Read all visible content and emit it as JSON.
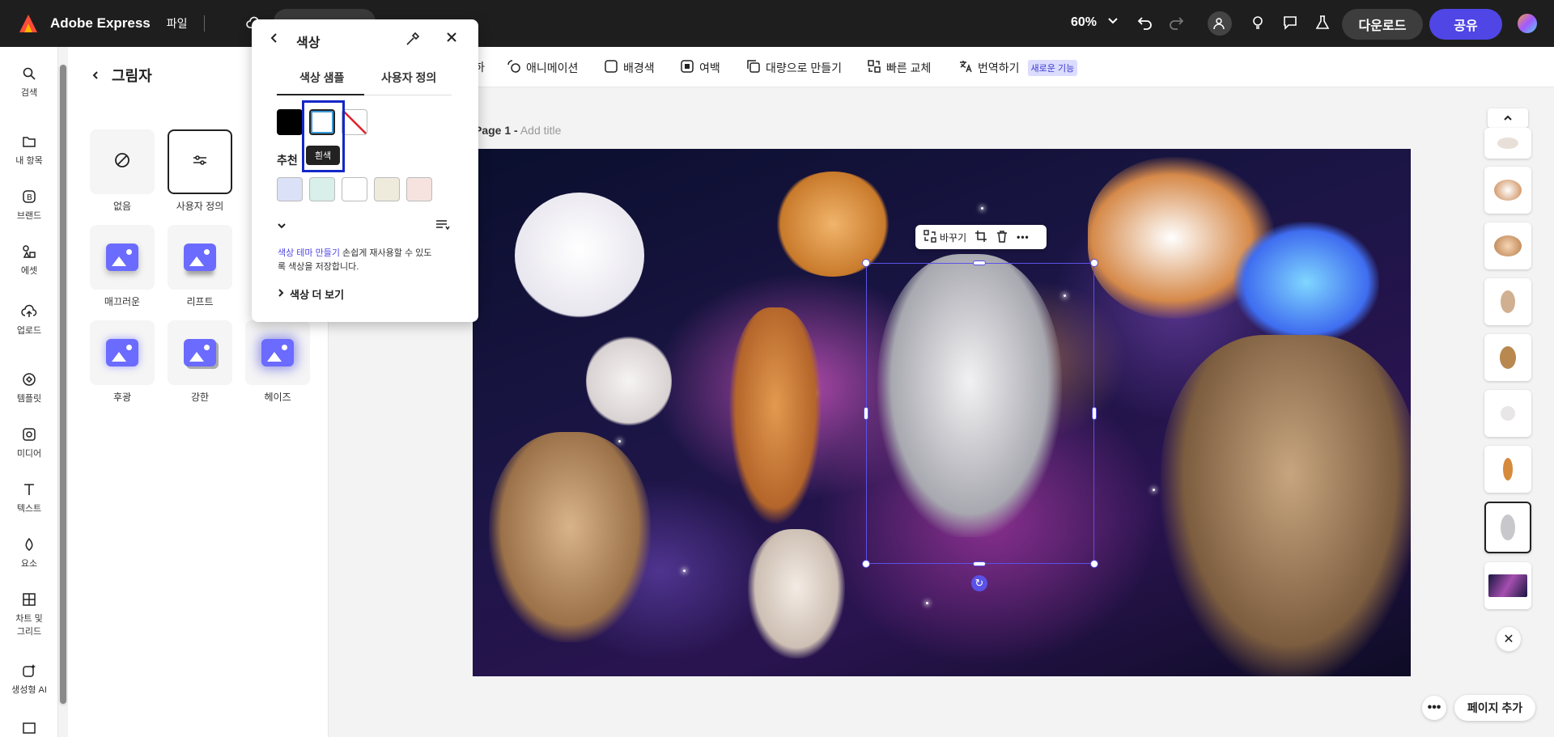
{
  "app": {
    "name": "Adobe Express",
    "file_menu": "파일",
    "zoom": "60%"
  },
  "header": {
    "download": "다운로드",
    "share": "공유"
  },
  "rail": [
    {
      "label": "검색",
      "icon": "search-icon"
    },
    {
      "label": "내 항목",
      "icon": "folder-icon"
    },
    {
      "label": "브랜드",
      "icon": "brand-icon"
    },
    {
      "label": "에셋",
      "icon": "assets-icon"
    },
    {
      "label": "업로드",
      "icon": "upload-icon"
    },
    {
      "label": "템플릿",
      "icon": "template-icon"
    },
    {
      "label": "미디어",
      "icon": "media-icon"
    },
    {
      "label": "텍스트",
      "icon": "text-icon"
    },
    {
      "label": "요소",
      "icon": "elements-icon"
    },
    {
      "label": "차트 및",
      "label2": "그리드",
      "icon": "chart-icon"
    },
    {
      "label": "생성형 AI",
      "icon": "ai-icon"
    }
  ],
  "shadow_panel": {
    "title": "그림자",
    "tiles": [
      {
        "label": "없음",
        "icon": "none-icon"
      },
      {
        "label": "사용자 정의",
        "icon": "sliders-icon"
      },
      {
        "label": "매끄러운",
        "icon": "image-icon"
      },
      {
        "label": "리프트",
        "icon": "image-icon"
      },
      {
        "label": "후광",
        "icon": "image-icon"
      },
      {
        "label": "강한",
        "icon": "image-icon"
      },
      {
        "label": "헤이즈",
        "icon": "image-icon"
      }
    ]
  },
  "toolbar": {
    "animation": "애니메이션",
    "background": "배경색",
    "margin": "여백",
    "bulk": "대량으로 만들기",
    "quick_replace": "빠른 교체",
    "translate": "번역하기",
    "new_badge": "새로운 기능"
  },
  "page": {
    "label": "Page 1 -",
    "title_placeholder": "Add title"
  },
  "float_tools": {
    "replace": "바꾸기"
  },
  "color_popup": {
    "title": "색상",
    "tab_swatches": "색상 샘플",
    "tab_custom": "사용자 정의",
    "recommended": "추천",
    "tooltip": "흰색",
    "theme_link": "색상 테마 만들기",
    "theme_text": " 손쉽게 재사용할 수 있도록 색상을 저장합니다.",
    "more_colors": "색상 더 보기",
    "swatches": [
      "#000000",
      "#ffffff",
      "none"
    ],
    "recommended_colors": [
      "#dbe2f7",
      "#d9efe9",
      "#ffffff",
      "#eeebdc",
      "#f6e3e0"
    ]
  },
  "footer": {
    "add_page": "페이지 추가"
  }
}
